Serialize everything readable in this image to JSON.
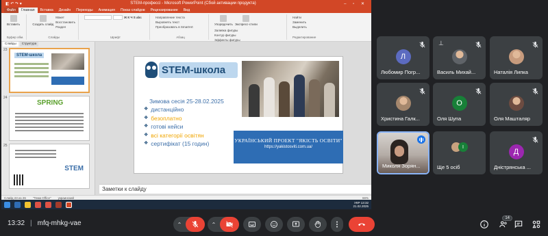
{
  "ppt": {
    "window_title": "STEM-профессі - Microsoft PowerPoint (Сбой активации продукта)",
    "menu_tabs": [
      "Файл",
      "Главная",
      "Вставка",
      "Дизайн",
      "Переходы",
      "Анимация",
      "Показ слайдов",
      "Рецензирование",
      "Вид"
    ],
    "ribbon": {
      "paste": "Вставить",
      "new_slide": "Создать слайд",
      "layout": "Макет",
      "reset": "Восстановить",
      "section": "Раздел",
      "clipboard": "Буфер обм.",
      "slides": "Слайды",
      "font": "Шрифт",
      "paragraph": "Абзац",
      "text_dir": "Направление текста",
      "align_text": "Выровнять текст",
      "smartart": "Преобразовать в SmartArt",
      "arrange": "Упорядочить",
      "quick_styles": "Экспресс-стили",
      "fill": "Заливка фигуры",
      "outline": "Контур фигуры",
      "effects": "Эффекты фигуры",
      "drawing": "Рисование",
      "find": "Найти",
      "replace": "Заменить",
      "select": "Выделить",
      "editing": "Редактирование"
    },
    "pane_tabs": [
      "Слайды",
      "Структура"
    ],
    "thumbs": [
      {
        "num": "23",
        "logo": "STEM-школа"
      },
      {
        "num": "24",
        "spring": "SPRING"
      },
      {
        "num": "25",
        "stem": "STEM"
      }
    ],
    "slide": {
      "logo": "STEM-школа",
      "session": "Зимова сесія 25-28.02.2025",
      "bullets": [
        {
          "text": "дистанційно",
          "color": "#3b6ea8"
        },
        {
          "text": "безоплатно",
          "color": "#f0a500"
        },
        {
          "text": "готові кейси",
          "color": "#3b6ea8"
        },
        {
          "text": "всі категорії освітян",
          "color": "#f0a500"
        },
        {
          "text": "сертифікат (15 годин)",
          "color": "#3b6ea8"
        }
      ],
      "banner_title": "УКРАЇНСЬКИЙ ПРОЕКТ \"ЯКІСТЬ ОСВІТИ\"",
      "banner_url": "https://yakistosviti.com.ua/"
    },
    "notes": "Заметки к слайду",
    "status": {
      "slide": "Слайд 23 из 26",
      "theme": "\"Тема Office\"",
      "lang": "украинский",
      "zoom": "66%"
    },
    "tray": {
      "lang": "УКР",
      "time": "13:32",
      "date": "21.02.2025"
    }
  },
  "participants": [
    {
      "name": "Любомир Погр...",
      "initial": "Л",
      "color": "#5c6bc0"
    },
    {
      "name": "Василь Михай...",
      "initial": "",
      "color": "#5f6368"
    },
    {
      "name": "Наталія Липка",
      "initial": "",
      "color": "#c79b7d"
    },
    {
      "name": "Христина Галк...",
      "initial": "",
      "color": "#a5876d"
    },
    {
      "name": "Оля Шупа",
      "initial": "О",
      "color": "#188038"
    },
    {
      "name": "Оля Машталяр",
      "initial": "",
      "color": "#6d4c41"
    },
    {
      "name": "Миколя Зорян...",
      "initial": "",
      "color": "#000000"
    },
    {
      "name": "Ще 5 осіб",
      "initial": "",
      "color": "#3c4043"
    },
    {
      "name": "Дністрянська ...",
      "initial": "Д",
      "color": "#9c27b0"
    }
  ],
  "meet": {
    "time": "13:32",
    "separator": "|",
    "code": "mfq-mhkg-vae",
    "participants_count": "14"
  }
}
